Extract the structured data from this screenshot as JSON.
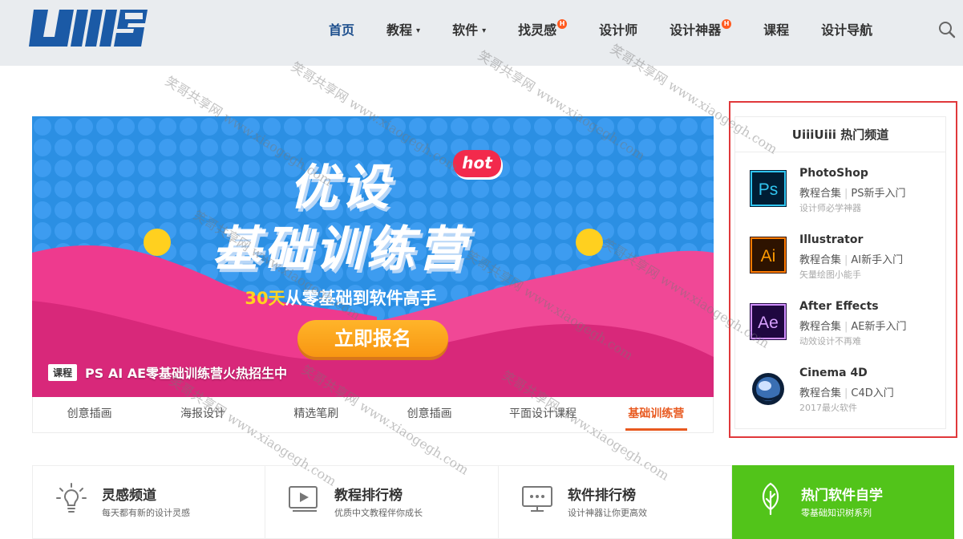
{
  "header": {
    "logo_text": "Uiii",
    "nav": [
      {
        "label": "首页",
        "caret": "",
        "hot": ""
      },
      {
        "label": "教程",
        "caret": "▾",
        "hot": ""
      },
      {
        "label": "软件",
        "caret": "▾",
        "hot": ""
      },
      {
        "label": "找灵感",
        "caret": "",
        "hot": "H"
      },
      {
        "label": "设计师",
        "caret": "",
        "hot": ""
      },
      {
        "label": "设计神器",
        "caret": "",
        "hot": "H"
      },
      {
        "label": "课程",
        "caret": "",
        "hot": ""
      },
      {
        "label": "设计导航",
        "caret": "",
        "hot": ""
      }
    ]
  },
  "banner": {
    "title_line1": "优设",
    "title_line2": "基础训练营",
    "badge": "hot",
    "subtitle_highlight": "30天",
    "subtitle_rest": "从零基础到软件高手",
    "cta": "立即报名",
    "tag": "课程",
    "caption": "PS AI AE零基础训练营火热招生中"
  },
  "banner_tabs": [
    "创意插画",
    "海报设计",
    "精选笔刷",
    "创意插画",
    "平面设计课程",
    "基础训练营"
  ],
  "sidebar": {
    "title": "UiiiUiii 热门频道",
    "items": [
      {
        "name": "PhotoShop",
        "link1": "教程合集",
        "sep": "|",
        "link2": "PS新手入门",
        "desc": "设计师必学神器",
        "icon": "ps-icon"
      },
      {
        "name": "Illustrator",
        "link1": "教程合集",
        "sep": "|",
        "link2": "AI新手入门",
        "desc": "矢量绘图小能手",
        "icon": "ai-icon"
      },
      {
        "name": "After Effects",
        "link1": "教程合集",
        "sep": "|",
        "link2": "AE新手入门",
        "desc": "动效设计不再难",
        "icon": "ae-icon"
      },
      {
        "name": "Cinema 4D",
        "link1": "教程合集",
        "sep": "|",
        "link2": "C4D入门",
        "desc": "2017最火软件",
        "icon": "c4d-icon"
      }
    ]
  },
  "features": [
    {
      "title": "灵感频道",
      "sub": "每天都有新的设计灵感",
      "icon": "lightbulb-icon"
    },
    {
      "title": "教程排行榜",
      "sub": "优质中文教程伴你成长",
      "icon": "video-icon"
    },
    {
      "title": "软件排行榜",
      "sub": "设计神器让你更高效",
      "icon": "monitor-icon"
    },
    {
      "title": "热门软件自学",
      "sub": "零基础知识树系列",
      "icon": "leaf-icon"
    }
  ],
  "watermark": {
    "text_cn": "笑哥共享网",
    "text_url": "www.xiaogegh.com"
  },
  "colors": {
    "header_bg": "#e9ecef",
    "logo_blue": "#1b5aa6",
    "accent_orange": "#e8591f",
    "highlight_red": "#e0383b",
    "green": "#52c41a"
  }
}
